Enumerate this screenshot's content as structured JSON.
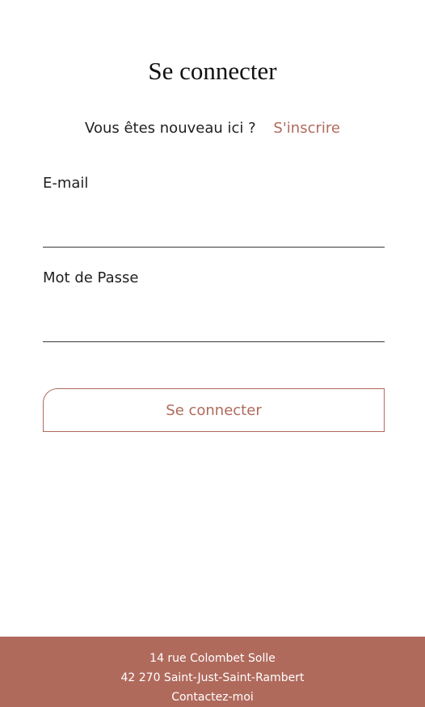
{
  "page": {
    "title": "Se connecter"
  },
  "signup": {
    "question": "Vous êtes nouveau ici ?",
    "link_label": "S'inscrire"
  },
  "form": {
    "email": {
      "label": "E-mail",
      "value": "",
      "placeholder": ""
    },
    "password": {
      "label": "Mot de Passe",
      "value": "",
      "placeholder": ""
    },
    "submit_label": "Se connecter"
  },
  "footer": {
    "address_line1": "14 rue Colombet Solle",
    "address_line2": "42 270 Saint-Just-Saint-Rambert",
    "contact_label": "Contactez-moi"
  },
  "colors": {
    "accent": "#b06a5c",
    "text": "#1f1f1f",
    "background": "#ffffff"
  }
}
